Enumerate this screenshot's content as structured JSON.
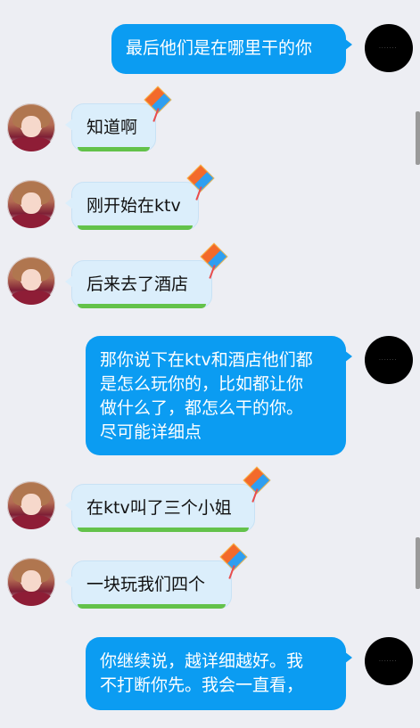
{
  "messages": [
    {
      "from": "me",
      "text": "最后他们是在哪里干的你"
    },
    {
      "from": "other",
      "text": "知道啊"
    },
    {
      "from": "other",
      "text": "刚开始在ktv"
    },
    {
      "from": "other",
      "text": "后来去了酒店"
    },
    {
      "from": "me",
      "text": "那你说下在ktv和酒店他们都\n是怎么玩你的，比如都让你\n做什么了，都怎么干的你。\n尽可能详细点"
    },
    {
      "from": "other",
      "text": "在ktv叫了三个小姐"
    },
    {
      "from": "other",
      "text": "一块玩我们四个"
    },
    {
      "from": "me",
      "text": "你继续说，越详细越好。我\n不打断你先。我会一直看，"
    }
  ],
  "colors": {
    "background": "#edeef3",
    "my_bubble": "#0b9cf2",
    "other_bubble": "#dbeefb"
  },
  "icons": {
    "my_avatar": "black-avatar-icon",
    "other_avatar": "girl-avatar-icon",
    "decoration": "kite-icon"
  }
}
